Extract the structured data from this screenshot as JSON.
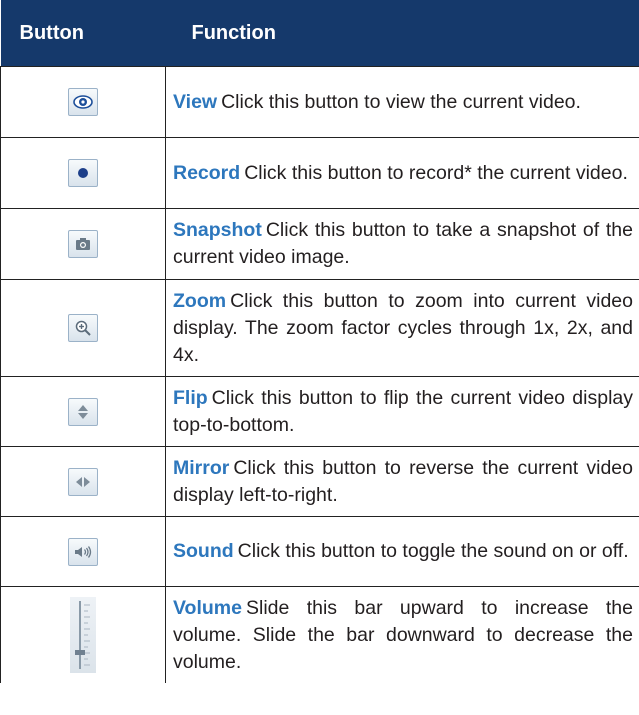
{
  "table": {
    "headers": {
      "button": "Button",
      "function": "Function"
    },
    "rows": [
      {
        "icon": "eye-icon",
        "keyword": "View",
        "text": "Click this button to view the current video."
      },
      {
        "icon": "record-dot-icon",
        "keyword": "Record",
        "text": "Click this button to record* the current video."
      },
      {
        "icon": "camera-icon",
        "keyword": "Snapshot",
        "text": "Click this button to take a snapshot of the current video image."
      },
      {
        "icon": "zoom-in-icon",
        "keyword": "Zoom",
        "text": "Click this button to zoom into current video display. The zoom factor cycles through 1x, 2x, and 4x."
      },
      {
        "icon": "flip-vertical-icon",
        "keyword": "Flip",
        "text": "Click this button to flip the current video display top-to-bottom."
      },
      {
        "icon": "mirror-horizontal-icon",
        "keyword": "Mirror",
        "text": "Click this button to reverse the current video display left-to-right."
      },
      {
        "icon": "speaker-icon",
        "keyword": "Sound",
        "text": "Click this button to toggle the sound on or off."
      },
      {
        "icon": "volume-slider-icon",
        "keyword": "Volume",
        "text": "Slide this bar upward to increase the volume. Slide the bar downward to decrease the volume."
      }
    ]
  },
  "colors": {
    "header_bg": "#15396b",
    "keyword": "#2d77bd",
    "text": "#231f20"
  }
}
